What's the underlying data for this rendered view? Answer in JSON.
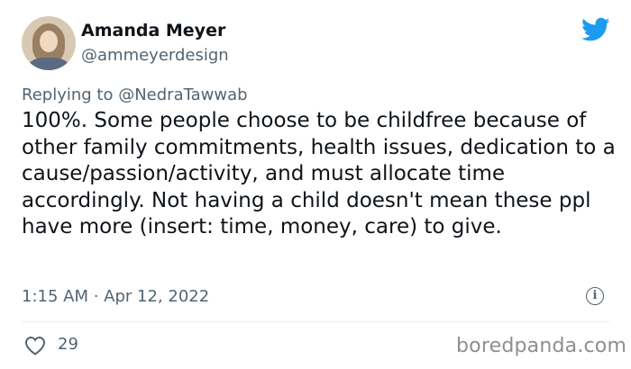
{
  "author": {
    "display_name": "Amanda Meyer",
    "handle": "@ammeyerdesign"
  },
  "reply": {
    "prefix": "Replying to ",
    "mention": "@NedraTawwab"
  },
  "tweet": {
    "text": "100%. Some people choose to be childfree because of other family commitments, health issues, dedication to a cause/passion/activity, and must allocate time accordingly. Not having a child doesn't mean these ppl have more (insert: time, money, care) to give.",
    "timestamp": "1:15 AM · Apr 12, 2022",
    "likes": "29"
  },
  "info_glyph": "i",
  "watermark": "boredpanda.com",
  "icons": {
    "brand": "twitter-bird-icon",
    "info": "info-icon",
    "like": "heart-icon"
  },
  "colors": {
    "brand": "#1d9bf0",
    "text_primary": "#0f1419",
    "text_secondary": "#536471",
    "divider": "#e6ecf0",
    "watermark": "#8e8e8e"
  }
}
